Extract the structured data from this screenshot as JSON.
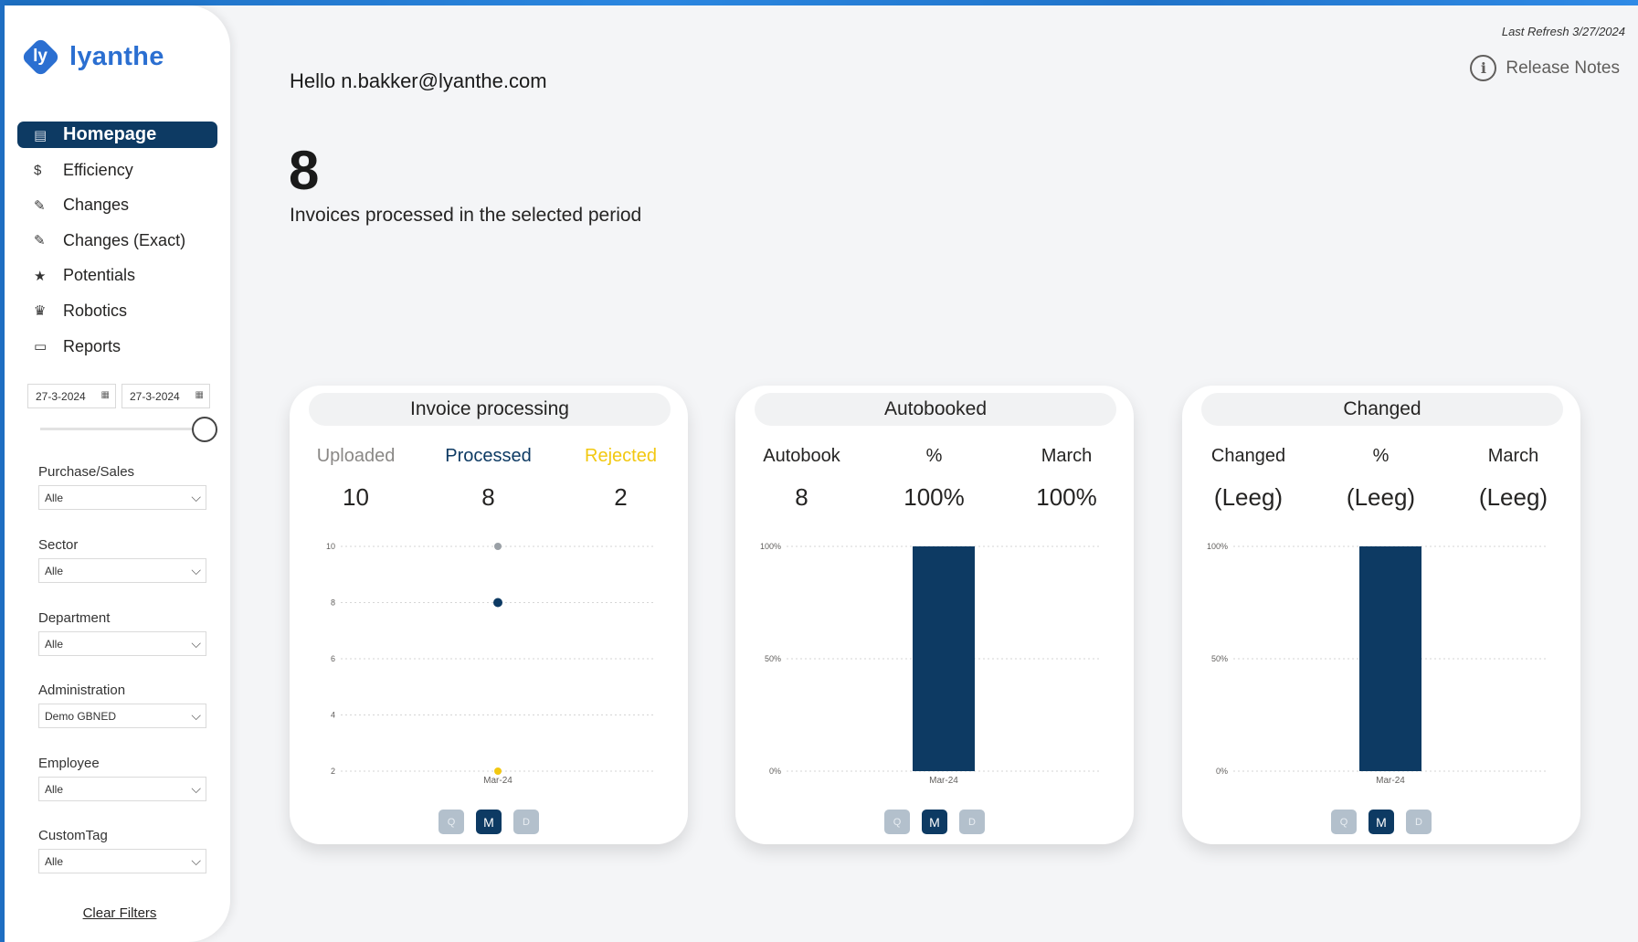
{
  "app": {
    "logo_mark": "ly",
    "logo_text": "lyanthe"
  },
  "colors": {
    "accent": "#0d3a63",
    "brand": "#2b6fd1",
    "rejected": "#f2c811",
    "uploaded_dot": "#9aa0a6"
  },
  "nav": [
    {
      "label": "Homepage",
      "icon": "document-icon",
      "glyph": "▤",
      "active": true
    },
    {
      "label": "Efficiency",
      "icon": "dollar-icon",
      "glyph": "$"
    },
    {
      "label": "Changes",
      "icon": "pencil-icon",
      "glyph": "✎"
    },
    {
      "label": "Changes (Exact)",
      "icon": "pencil-icon",
      "glyph": "✎"
    },
    {
      "label": "Potentials",
      "icon": "star-icon",
      "glyph": "★"
    },
    {
      "label": "Robotics",
      "icon": "robot-icon",
      "glyph": "♛"
    },
    {
      "label": "Reports",
      "icon": "book-icon",
      "glyph": "▭"
    }
  ],
  "dates": {
    "from": "27-3-2024",
    "to": "27-3-2024"
  },
  "filters": [
    {
      "label": "Purchase/Sales",
      "value": "Alle"
    },
    {
      "label": "Sector",
      "value": "Alle"
    },
    {
      "label": "Department",
      "value": "Alle"
    },
    {
      "label": "Administration",
      "value": "Demo GBNED"
    },
    {
      "label": "Employee",
      "value": "Alle"
    },
    {
      "label": "CustomTag",
      "value": "Alle"
    }
  ],
  "clear_filters": "Clear Filters",
  "header": {
    "last_refresh": "Last Refresh 3/27/2024",
    "release_notes": "Release Notes",
    "info_glyph": "i",
    "hello": "Hello n.bakker@lyanthe.com",
    "count": "8",
    "count_caption": "Invoices processed in the selected period"
  },
  "cards": [
    {
      "title": "Invoice processing",
      "kpis": [
        {
          "label": "Uploaded",
          "value": "10",
          "color": "#8a8886"
        },
        {
          "label": "Processed",
          "value": "8",
          "color": "#0d3a63"
        },
        {
          "label": "Rejected",
          "value": "2",
          "color": "#f2c811"
        }
      ],
      "buttons": [
        "Q",
        "M",
        "D"
      ],
      "active_button": "M"
    },
    {
      "title": "Autobooked",
      "kpis": [
        {
          "label": "Autobook",
          "value": "8"
        },
        {
          "label": "%",
          "value": "100%"
        },
        {
          "label": "March",
          "value": "100%"
        }
      ],
      "buttons": [
        "Q",
        "M",
        "D"
      ],
      "active_button": "M"
    },
    {
      "title": "Changed",
      "kpis": [
        {
          "label": "Changed",
          "value": "(Leeg)"
        },
        {
          "label": "%",
          "value": "(Leeg)"
        },
        {
          "label": "March",
          "value": "(Leeg)"
        }
      ],
      "buttons": [
        "Q",
        "M",
        "D"
      ],
      "active_button": "M"
    }
  ],
  "chart_data": [
    {
      "type": "scatter",
      "categories": [
        "Mar-24"
      ],
      "yticks": [
        "10",
        "8",
        "6",
        "4",
        "2"
      ],
      "ylim": [
        2,
        10
      ],
      "series": [
        {
          "name": "Uploaded",
          "values": [
            10
          ],
          "color": "#9aa0a6"
        },
        {
          "name": "Processed",
          "values": [
            8
          ],
          "color": "#0d3a63"
        },
        {
          "name": "Rejected",
          "values": [
            2
          ],
          "color": "#f2c811"
        }
      ]
    },
    {
      "type": "bar",
      "categories": [
        "Mar-24"
      ],
      "yticks": [
        "100%",
        "50%",
        "0%"
      ],
      "ylim": [
        0,
        100
      ],
      "values": [
        100
      ],
      "color": "#0d3a63"
    },
    {
      "type": "bar",
      "categories": [
        "Mar-24"
      ],
      "yticks": [
        "100%",
        "50%",
        "0%"
      ],
      "ylim": [
        0,
        100
      ],
      "values": [
        100
      ],
      "color": "#0d3a63"
    }
  ]
}
